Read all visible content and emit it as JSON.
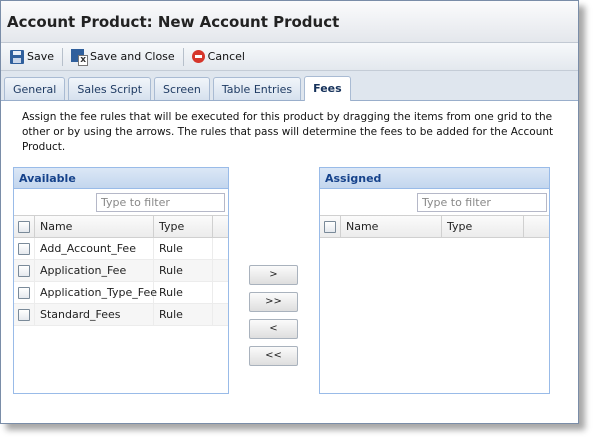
{
  "window": {
    "title": "Account Product: New Account Product"
  },
  "toolbar": {
    "save_label": "Save",
    "save_close_label": "Save and Close",
    "cancel_label": "Cancel"
  },
  "tabs": [
    {
      "label": "General",
      "active": false
    },
    {
      "label": "Sales Script",
      "active": false
    },
    {
      "label": "Screen",
      "active": false
    },
    {
      "label": "Table Entries",
      "active": false
    },
    {
      "label": "Fees",
      "active": true
    }
  ],
  "description": "Assign the fee rules that will be executed for this product by dragging the items from one grid to the other or by using the arrows. The rules that pass will determine the fees to be added for the Account Product.",
  "available": {
    "title": "Available",
    "filter_placeholder": "Type to filter",
    "columns": {
      "name": "Name",
      "type": "Type"
    },
    "rows": [
      {
        "name": "Add_Account_Fee",
        "type": "Rule"
      },
      {
        "name": "Application_Fee",
        "type": "Rule"
      },
      {
        "name": "Application_Type_Fee",
        "type": "Rule"
      },
      {
        "name": "Standard_Fees",
        "type": "Rule"
      }
    ]
  },
  "assigned": {
    "title": "Assigned",
    "filter_placeholder": "Type to filter",
    "columns": {
      "name": "Name",
      "type": "Type"
    },
    "rows": []
  },
  "arrows": {
    "move_right": ">",
    "move_all_right": ">>",
    "move_left": "<",
    "move_all_left": "<<"
  },
  "colors": {
    "grid_header_text": "#15428b",
    "grid_border": "#99bbe8",
    "cancel_icon": "#d6362b",
    "save_icon": "#2f5f9c"
  }
}
